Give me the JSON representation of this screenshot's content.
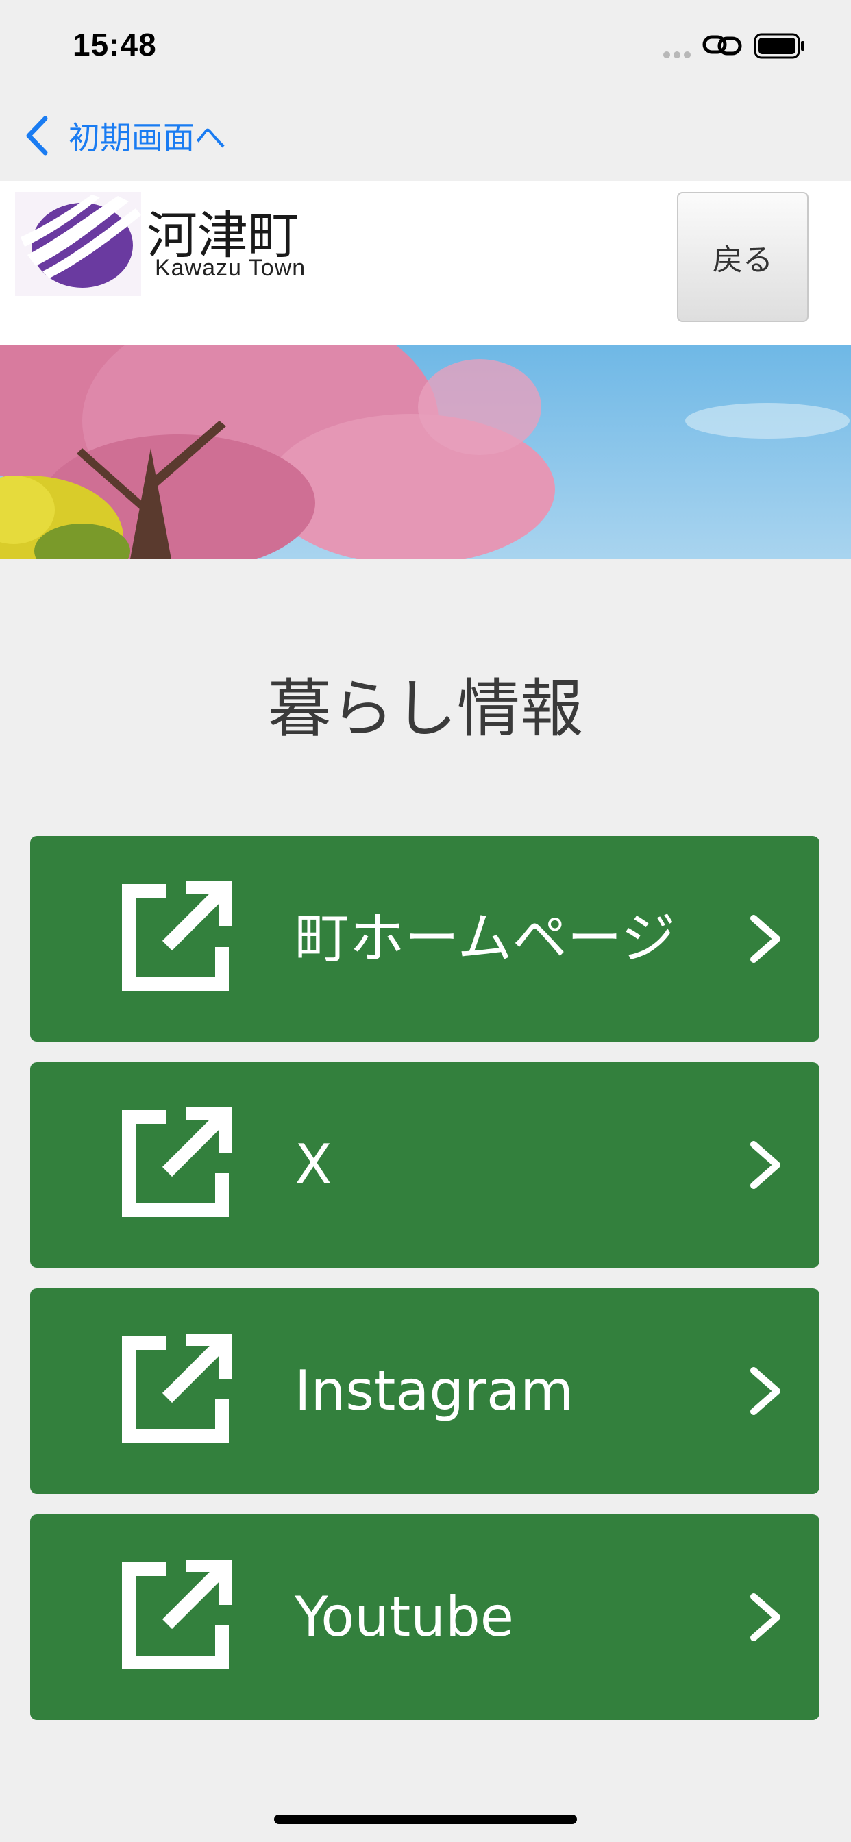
{
  "status_bar": {
    "time": "15:48"
  },
  "nav": {
    "back_label": "初期画面へ"
  },
  "header": {
    "title": "河津町",
    "subtitle": "Kawazu Town",
    "back_button_label": "戻る"
  },
  "section": {
    "title": "暮らし情報"
  },
  "links": [
    {
      "label": "町ホームページ",
      "icon": "external-link-icon"
    },
    {
      "label": "X",
      "icon": "external-link-icon"
    },
    {
      "label": "Instagram",
      "icon": "external-link-icon"
    },
    {
      "label": "Youtube",
      "icon": "external-link-icon"
    }
  ],
  "colors": {
    "accent_blue": "#1a7cf2",
    "button_green": "#33803d",
    "logo_purple": "#6a3aa0",
    "background": "#efefef"
  }
}
